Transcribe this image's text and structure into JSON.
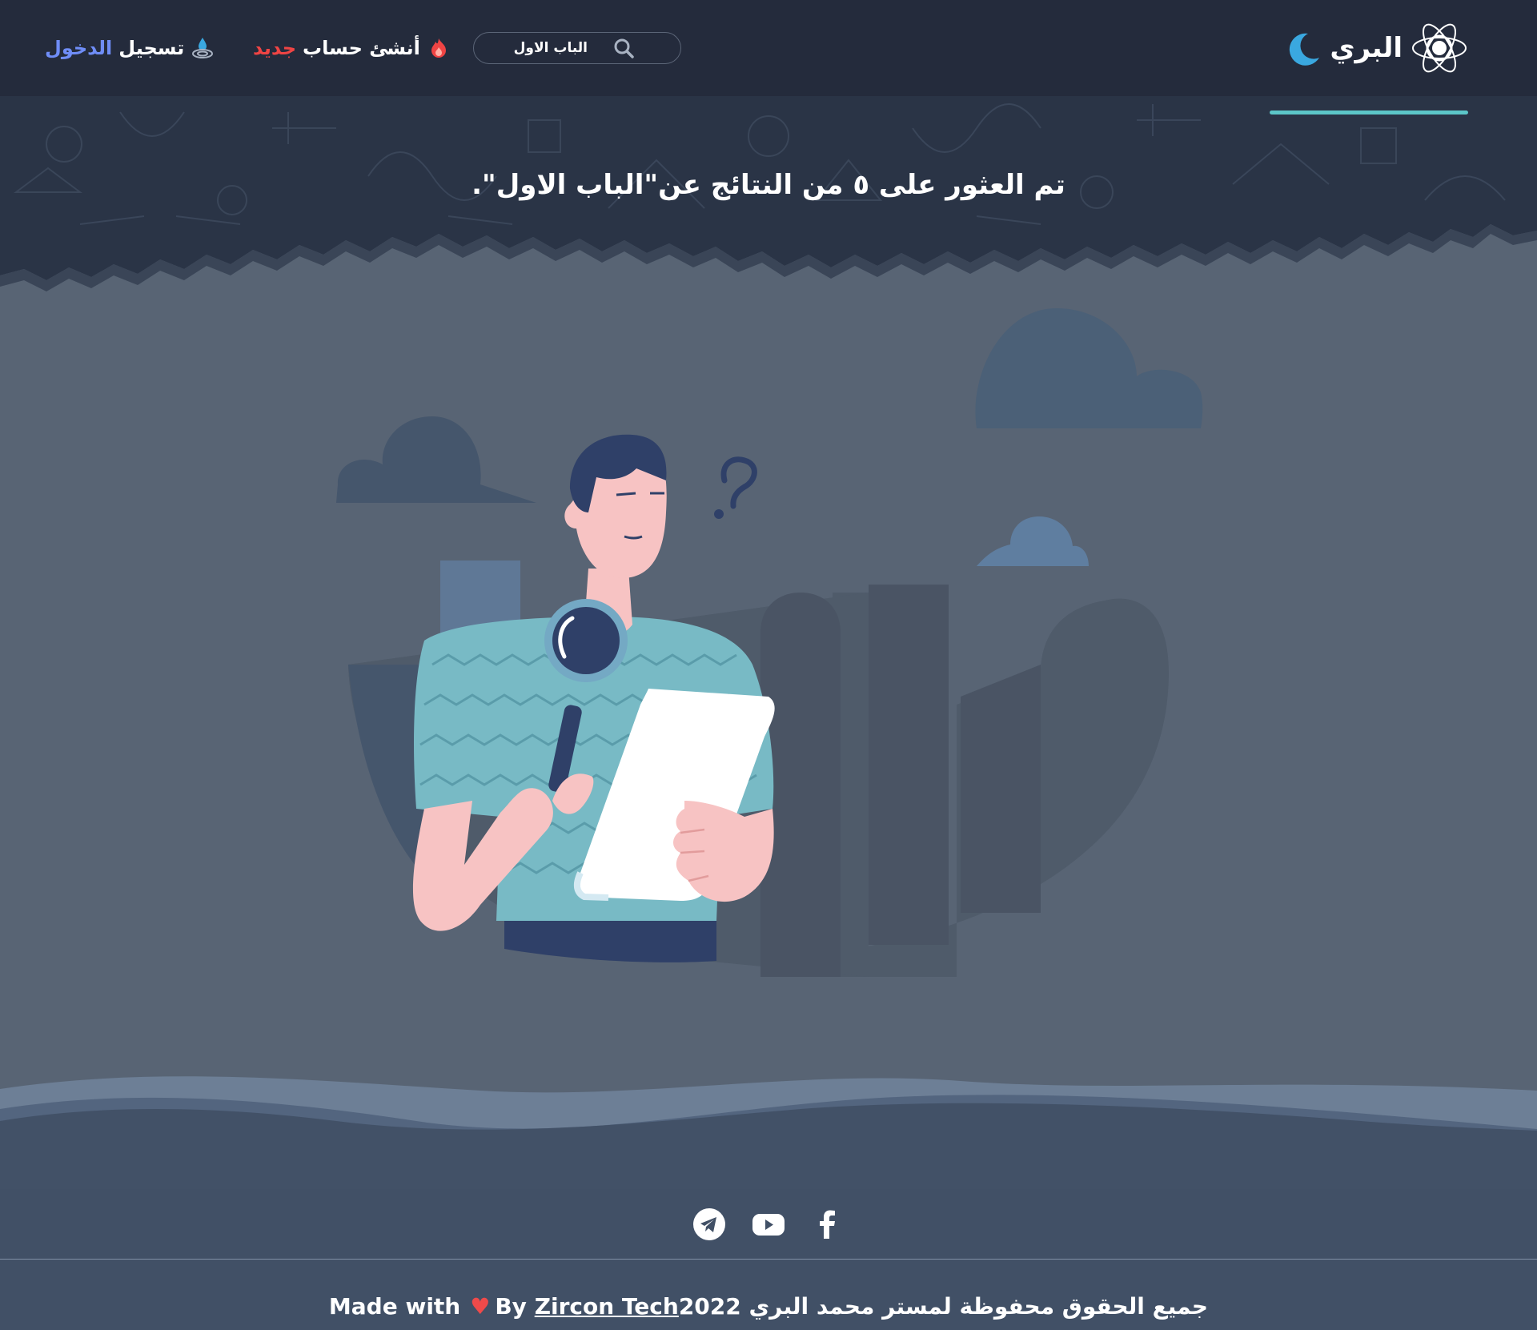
{
  "header": {
    "brand": "البري",
    "search": {
      "value": "الباب الاول",
      "placeholder": "الباب الاول"
    },
    "register": {
      "prefix": "أنشئ حساب",
      "highlight": "جديد"
    },
    "login": {
      "prefix": "تسجيل",
      "highlight": "الدخول"
    }
  },
  "hero": {
    "title": "تم العثور على ٥ من النتائج عن\"الباب الاول\"."
  },
  "footer": {
    "made_with": "Made with",
    "by": "By",
    "company": "Zircon Tech",
    "year": "2022",
    "rights": "جميع الحقوق محفوظة لمستر محمد البري"
  },
  "colors": {
    "header_bg": "#242b3c",
    "body_bg": "#586474",
    "accent_teal": "#5cc6c8",
    "accent_red": "#ef4444",
    "accent_blue": "#6f8df7",
    "footer_bg": "#415066"
  },
  "icons": {
    "logo": "atom-icon",
    "theme_toggle": "moon-icon",
    "search": "search-icon",
    "register": "fire-icon",
    "login": "water-drop-icon",
    "social": [
      "telegram-icon",
      "youtube-icon",
      "facebook-icon"
    ]
  }
}
